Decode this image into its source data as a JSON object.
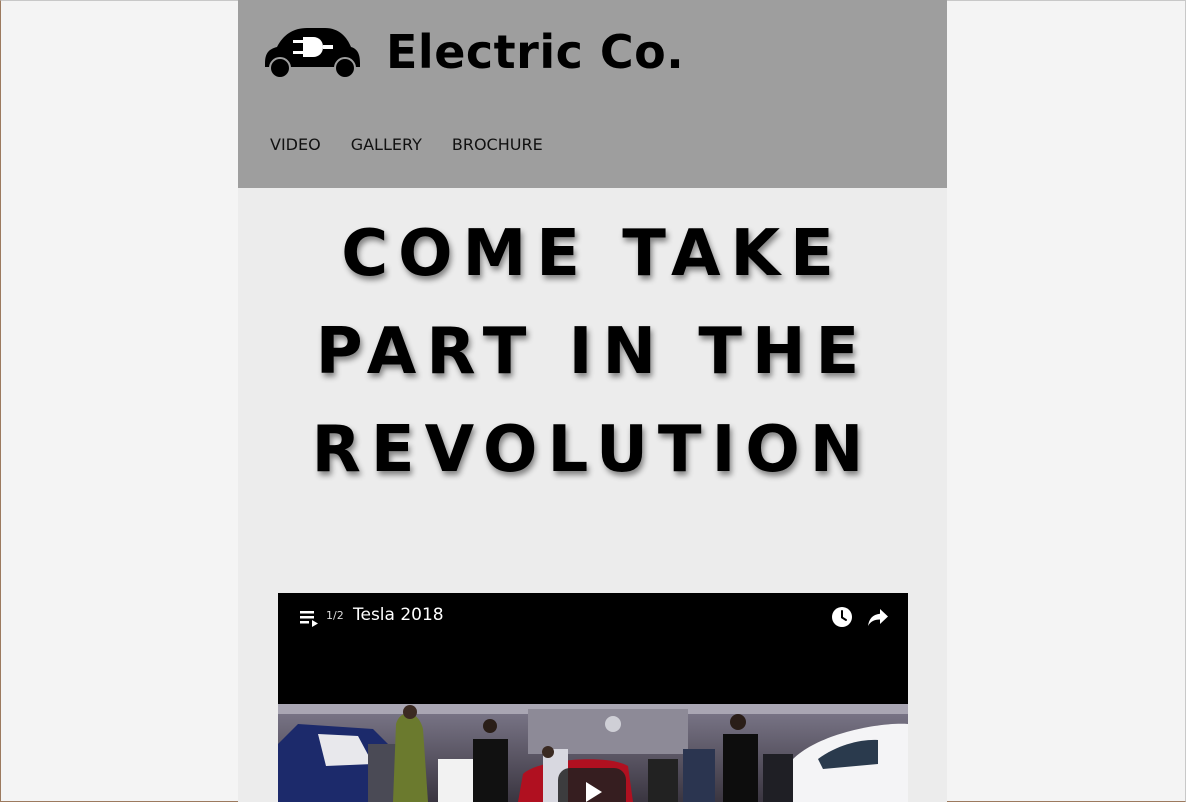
{
  "header": {
    "site_title": "Electric Co.",
    "logo_icon": "electric-car-plug-icon",
    "background_color": "#9e9e9e"
  },
  "nav": {
    "items": [
      {
        "label": "VIDEO"
      },
      {
        "label": "GALLERY"
      },
      {
        "label": "BROCHURE"
      }
    ]
  },
  "hero": {
    "lines": [
      "COME TAKE",
      "PART IN THE",
      "REVOLUTION"
    ]
  },
  "video": {
    "playlist_icon": "playlist-icon",
    "playlist_position": "1/2",
    "title": "Tesla 2018",
    "watch_later_icon": "clock-icon",
    "share_icon": "share-icon",
    "play_icon": "play-icon"
  },
  "colors": {
    "page_background": "#f4f4f4",
    "content_background": "#ececec",
    "header_background": "#9e9e9e",
    "video_background": "#000000"
  }
}
